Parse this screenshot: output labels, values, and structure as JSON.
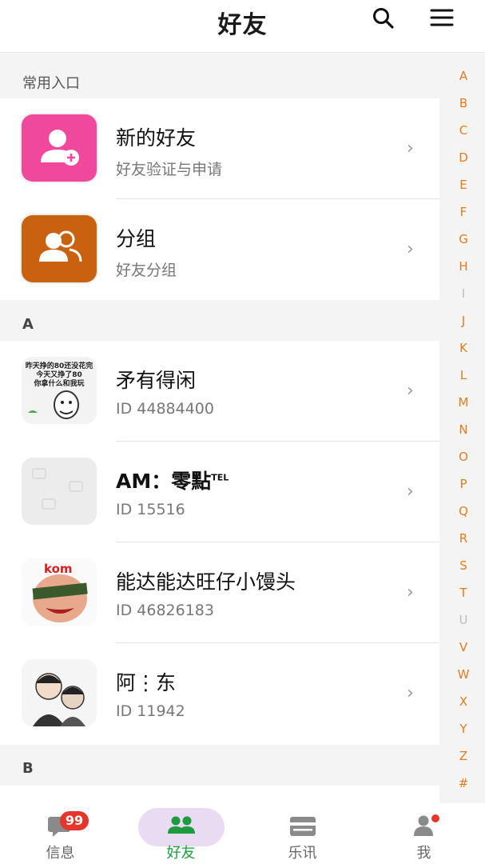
{
  "header": {
    "title": "好友"
  },
  "sections": {
    "common": "常用入口",
    "a": "A",
    "b": "B"
  },
  "entries": [
    {
      "title": "新的好友",
      "sub": "好友验证与申请"
    },
    {
      "title": "分组",
      "sub": "好友分组"
    }
  ],
  "friends": [
    {
      "name": "矛有得闲",
      "id": "ID 44884400",
      "avatar_caption": [
        "昨天挣的80还没花完",
        "今天又挣了80",
        "你拿什么和我玩"
      ]
    },
    {
      "name": "AM：零點",
      "name_sup": "TEL",
      "id": "ID 15516"
    },
    {
      "name": "能达能达旺仔小馒头",
      "id": "ID 46826183",
      "avatar_caption": [
        "kom"
      ]
    },
    {
      "name": "阿⋮东",
      "id": "ID 11942"
    }
  ],
  "chevron": "›",
  "index_letters": [
    "A",
    "B",
    "C",
    "D",
    "E",
    "F",
    "G",
    "H",
    "I",
    "J",
    "K",
    "L",
    "M",
    "N",
    "O",
    "P",
    "Q",
    "R",
    "S",
    "T",
    "U",
    "V",
    "W",
    "X",
    "Y",
    "Z",
    "#"
  ],
  "tabs": [
    {
      "label": "信息",
      "badge": "99"
    },
    {
      "label": "好友"
    },
    {
      "label": "乐讯"
    },
    {
      "label": "我"
    }
  ],
  "colors": {
    "accent": "#1c9b3f",
    "index": "#e07b1f",
    "badge": "#e4362b",
    "pink": "#f0499b",
    "orange": "#c8620f"
  }
}
